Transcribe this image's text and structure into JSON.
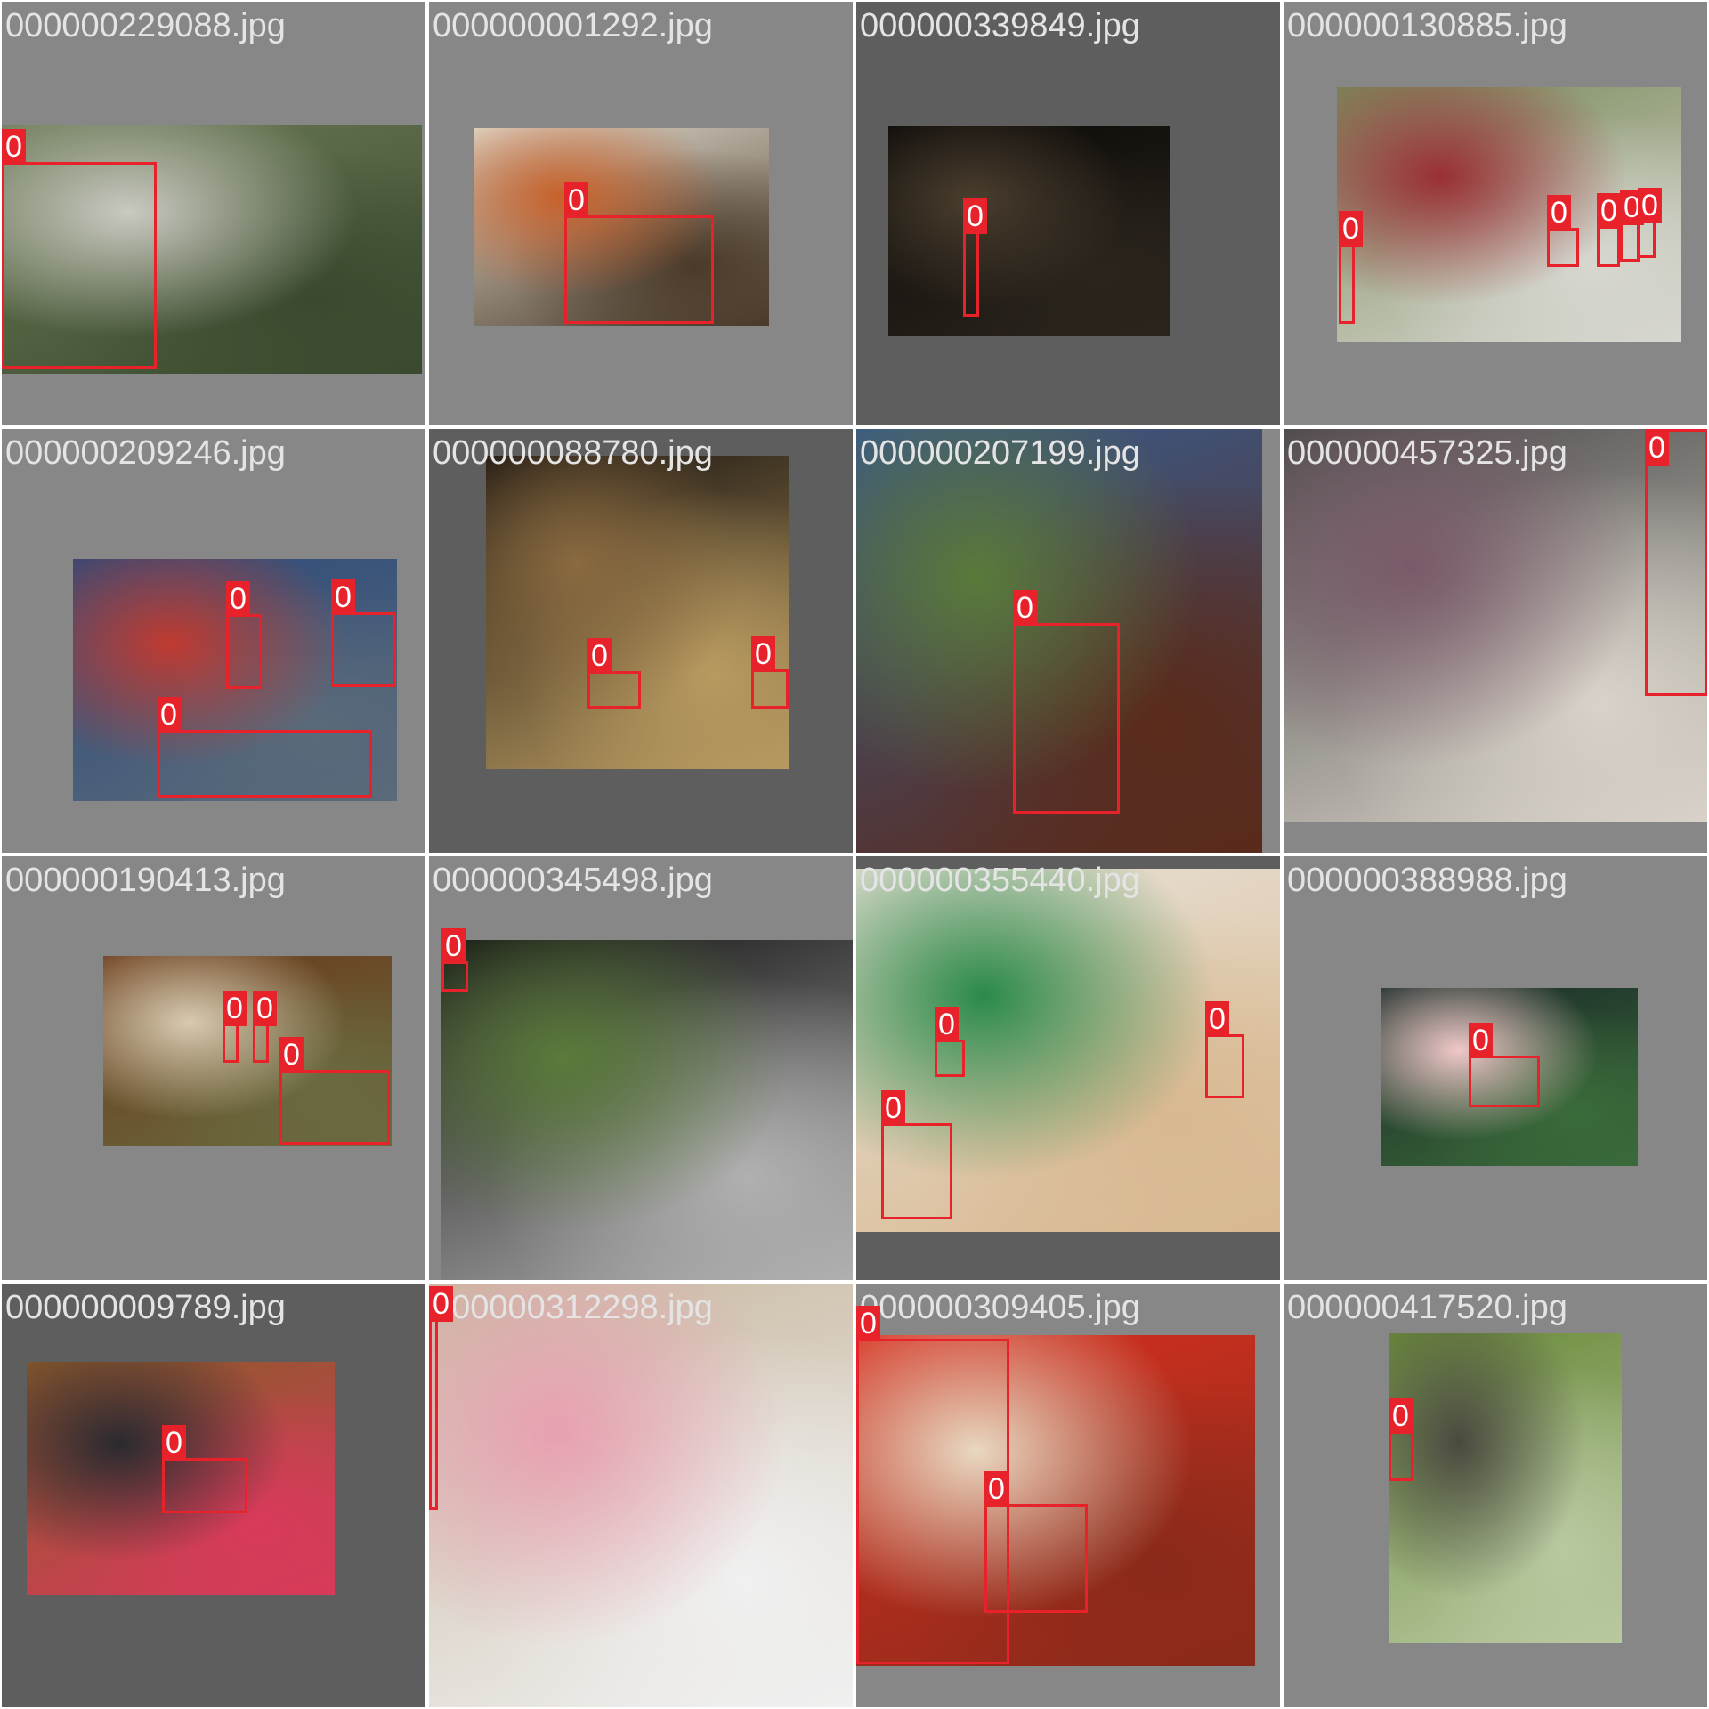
{
  "tiles": [
    {
      "filename": "000000229088.jpg",
      "bg": "light",
      "photo_colors": [
        "#6b7a55",
        "#c9c9c0",
        "#3a4a2e"
      ],
      "boxes": [
        {
          "label": "0"
        }
      ]
    },
    {
      "filename": "000000001292.jpg",
      "bg": "light",
      "photo_colors": [
        "#e2ddd0",
        "#c8612a",
        "#4a3a2a"
      ],
      "boxes": [
        {
          "label": "0"
        }
      ]
    },
    {
      "filename": "000000339849.jpg",
      "bg": "dark",
      "photo_colors": [
        "#0c0a08",
        "#4a3e2e",
        "#2a241c"
      ],
      "boxes": [
        {
          "label": "0"
        }
      ]
    },
    {
      "filename": "000000130885.jpg",
      "bg": "light",
      "photo_colors": [
        "#7a8a5a",
        "#9a2f35",
        "#d7d7d0"
      ],
      "boxes": [
        {
          "label": "0"
        },
        {
          "label": "0"
        },
        {
          "label": "0"
        },
        {
          "label": "0"
        },
        {
          "label": "0"
        }
      ]
    },
    {
      "filename": "000000209246.jpg",
      "bg": "light",
      "photo_colors": [
        "#2c4a7a",
        "#c03a30",
        "#5a6a7a"
      ],
      "boxes": [
        {
          "label": "0"
        },
        {
          "label": "0"
        },
        {
          "label": "0"
        }
      ]
    },
    {
      "filename": "000000088780.jpg",
      "bg": "dark",
      "photo_colors": [
        "#1a1410",
        "#8a6a40",
        "#b89a60"
      ],
      "boxes": [
        {
          "label": "0"
        },
        {
          "label": "0"
        }
      ]
    },
    {
      "filename": "000000207199.jpg",
      "bg": "light",
      "photo_colors": [
        "#3a5a8a",
        "#5a7a3a",
        "#5a2a1a"
      ],
      "boxes": [
        {
          "label": "0"
        }
      ]
    },
    {
      "filename": "000000457325.jpg",
      "bg": "light",
      "photo_colors": [
        "#4a4a4a",
        "#7a5a6a",
        "#d8d2c8"
      ],
      "boxes": [
        {
          "label": "0"
        }
      ]
    },
    {
      "filename": "000000190413.jpg",
      "bg": "light",
      "photo_colors": [
        "#6a3a1a",
        "#d8cab0",
        "#6a6a40"
      ],
      "boxes": [
        {
          "label": "0"
        },
        {
          "label": "0"
        },
        {
          "label": "0"
        }
      ]
    },
    {
      "filename": "000000345498.jpg",
      "bg": "light",
      "photo_colors": [
        "#101010",
        "#5a7a3a",
        "#b0b0b0"
      ],
      "boxes": [
        {
          "label": "0"
        }
      ]
    },
    {
      "filename": "000000355440.jpg",
      "bg": "dark",
      "photo_colors": [
        "#e8e2d8",
        "#2a8a4a",
        "#d8b890"
      ],
      "boxes": [
        {
          "label": "0"
        },
        {
          "label": "0"
        },
        {
          "label": "0"
        }
      ]
    },
    {
      "filename": "000000388988.jpg",
      "bg": "light",
      "photo_colors": [
        "#1a2a28",
        "#f0c8c8",
        "#3a6a3a"
      ],
      "boxes": [
        {
          "label": "0"
        }
      ]
    },
    {
      "filename": "000000009789.jpg",
      "bg": "dark",
      "photo_colors": [
        "#8a5a2a",
        "#2a2a30",
        "#d83a5a"
      ],
      "boxes": [
        {
          "label": "0"
        }
      ]
    },
    {
      "filename": "000000312298.jpg",
      "bg": "light",
      "photo_colors": [
        "#c8b8a0",
        "#e8a0b0",
        "#f0f0f0"
      ],
      "boxes": [
        {
          "label": "0"
        }
      ]
    },
    {
      "filename": "000000309405.jpg",
      "bg": "light",
      "photo_colors": [
        "#d83020",
        "#e8d8c0",
        "#8a2a1a"
      ],
      "boxes": [
        {
          "label": "0"
        },
        {
          "label": "0"
        }
      ]
    },
    {
      "filename": "000000417520.jpg",
      "bg": "light",
      "photo_colors": [
        "#6a8a3a",
        "#4a4a40",
        "#b8c8a0"
      ],
      "boxes": [
        {
          "label": "0"
        }
      ]
    }
  ]
}
